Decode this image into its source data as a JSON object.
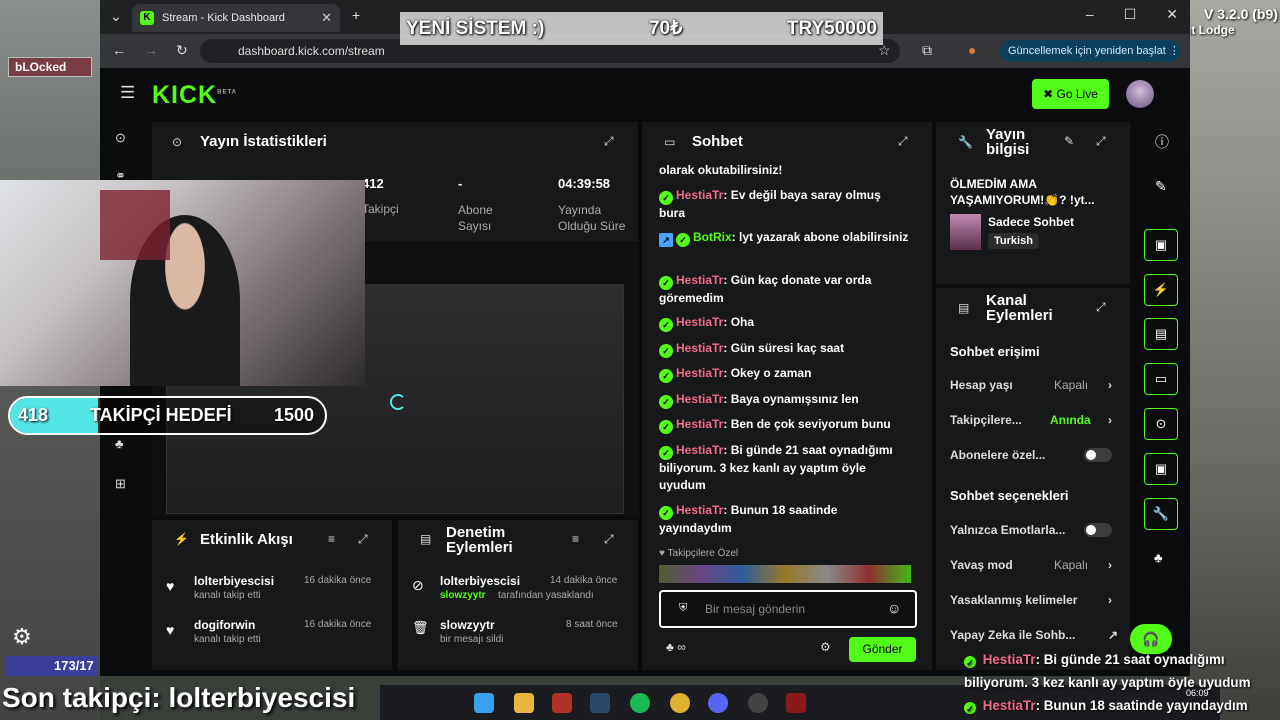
{
  "stream_overlay": {
    "blocked_label": "bLOcked",
    "version": "V 3.2.0 (b9)",
    "lodge": "it Lodge",
    "banner_left": "YENİ SİSTEM :)",
    "banner_mid": "70₺",
    "banner_right": "TRY50000",
    "goal_current": "418",
    "goal_label": "TAKİPÇİ HEDEFİ",
    "goal_target": "1500",
    "goal_progress": 0.28,
    "last_follower": "Son takipçi: lolterbiyescisi",
    "viewer_count": "173/17",
    "bottom_chat": [
      {
        "user": "HestiaTr",
        "text": ": Bi günde 21 saat oynadığımı biliyorum. 3 kez kanlı ay yaptım öyle uyudum"
      },
      {
        "user": "HestiaTr",
        "text": ": Bunun 18 saatinde yayındaydım"
      }
    ],
    "clock": "06:09"
  },
  "browser": {
    "tab_title": "Stream - Kick Dashboard",
    "url": "dashboard.kick.com/stream",
    "update_label": "Güncellemek için yeniden başlat"
  },
  "kick": {
    "logo": "KICK",
    "beta": "BETA",
    "go_live": "Go Live"
  },
  "stats": {
    "title": "Yayın İstatistikleri",
    "followers_value": "412",
    "followers_label": "Takipçi",
    "subs_value": "-",
    "subs_label": "Abone Sayısı",
    "uptime_value": "04:39:58",
    "uptime_label": "Yayında Olduğu Süre"
  },
  "activity": {
    "title": "Etkinlik Akışı",
    "items": [
      {
        "user": "lolterbiyescisi",
        "time": "16 dakika önce",
        "action": "kanalı takip etti"
      },
      {
        "user": "dogiforwin",
        "time": "16 dakika önce",
        "action": "kanalı takip etti"
      }
    ]
  },
  "moderation": {
    "title": "Denetim Eylemleri",
    "items": [
      {
        "user": "lolterbiyescisi",
        "time": "14 dakika önce",
        "actor": "slowzyytr",
        "action": "tarafından yasaklandı"
      },
      {
        "user": "slowzyytr",
        "time": "8 saat önce",
        "action": "bir mesajı sildi"
      }
    ]
  },
  "chat": {
    "title": "Sohbet",
    "top_partial": "olarak okutabilirsiniz!",
    "messages": [
      {
        "user": "HestiaTr",
        "text": "Ev değil baya saray olmuş bura"
      },
      {
        "user": "BotRix",
        "text": "lyt yazarak abone olabilirsiniz"
      },
      {
        "user": "HestiaTr",
        "text": "Gün kaç donate var orda göremedim"
      },
      {
        "user": "HestiaTr",
        "text": "Oha"
      },
      {
        "user": "HestiaTr",
        "text": "Gün süresi kaç saat"
      },
      {
        "user": "HestiaTr",
        "text": "Okey o zaman"
      },
      {
        "user": "HestiaTr",
        "text": "Baya oynamışsınız len"
      },
      {
        "user": "HestiaTr",
        "text": "Ben de çok seviyorum bunu"
      },
      {
        "user": "HestiaTr",
        "text": "Bi günde 21 saat oynadığımı biliyorum. 3 kez kanlı ay yaptım öyle uyudum"
      },
      {
        "user": "HestiaTr",
        "text": "Bunun 18 saatinde yayındaydım"
      }
    ],
    "followers_only": "Takipçilere Özel",
    "placeholder": "Bir mesaj gönderin",
    "send": "Gönder"
  },
  "stream_info": {
    "title": "Yayın bilgisi",
    "stream_title": "ÖLMEDİM AMA YAŞAMIYORUM!👏? !yt...",
    "category": "Sadece Sohbet",
    "language": "Turkish"
  },
  "channel_actions": {
    "title": "Kanal Eylemleri",
    "chat_access": "Sohbet erişimi",
    "rows1": [
      {
        "label": "Hesap yaşı",
        "value": "Kapalı"
      },
      {
        "label": "Takipçilere...",
        "value": "Anında"
      },
      {
        "label": "Abonelere özel...",
        "value": ""
      }
    ],
    "chat_options": "Sohbet seçenekleri",
    "rows2": [
      {
        "label": "Yalnızca Emotlarla...",
        "value": ""
      },
      {
        "label": "Yavaş mod",
        "value": "Kapalı"
      },
      {
        "label": "Yasaklanmış kelimeler",
        "value": ""
      },
      {
        "label": "Yapay Zeka ile Sohb...",
        "value": ""
      }
    ]
  },
  "colors": {
    "accent": "#53fc18",
    "username": "#f26b8a"
  }
}
